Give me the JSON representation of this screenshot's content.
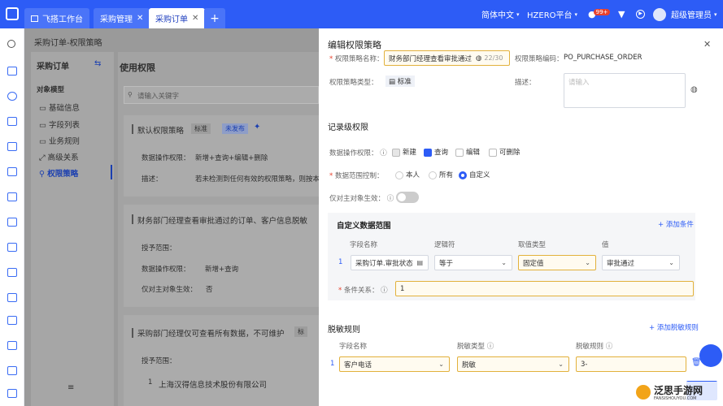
{
  "topbar": {
    "tabs": [
      {
        "label": "飞搭工作台"
      },
      {
        "label": "采购管理"
      },
      {
        "label": "采购订单"
      }
    ],
    "add": "+",
    "lang": "简体中文",
    "platform": "HZERO平台",
    "badge": "99+",
    "user": "超级管理员"
  },
  "bg": {
    "breadcrumb": "采购订单-权限策略",
    "nav_title": "采购订单",
    "section_label": "对象模型",
    "nav_items": [
      "基础信息",
      "字段列表",
      "业务规则",
      "高级关系",
      "权限策略"
    ],
    "col_title": "使用权限",
    "search_placeholder": "请输入关键字",
    "card1": {
      "title": "默认权限策略",
      "tag1": "标准",
      "tag2": "未发布",
      "ops_label": "数据操作权限：",
      "ops_value": "新增+查询+编辑+删除",
      "desc_label": "描述：",
      "desc_value": "若未检测到任何有效的权限策略，则按本策"
    },
    "card2": {
      "title": "财务部门经理查看审批通过的订单、客户信息脱敏",
      "scope_label": "授予范围：",
      "ops_label": "数据操作权限：",
      "ops_value": "新增+查询",
      "owner_label": "仅对主对象生效：",
      "owner_value": "否"
    },
    "card3": {
      "title": "采购部门经理仅可查看所有数据，不可维护",
      "tag": "标",
      "scope_label": "授予范围：",
      "index": "1",
      "company": "上海汉得信息技术股份有限公司"
    }
  },
  "panel": {
    "title": "编辑权限策略",
    "name_label": "权限策略名称：",
    "name_value": "财务部门经理查看审批通过",
    "name_count": "22/30",
    "code_label": "权限策略编码：",
    "code_value": "PO_PURCHASE_ORDER",
    "type_label": "权限策略类型：",
    "type_value": "标准",
    "desc_label": "描述：",
    "desc_placeholder": "请输入",
    "record_title": "记录级权限",
    "ops_label": "数据操作权限：",
    "ops": [
      "新建",
      "查询",
      "编辑",
      "可删除"
    ],
    "range_label": "数据范围控制：",
    "ranges": [
      "本人",
      "所有",
      "自定义"
    ],
    "main_only_label": "仅对主对象生效：",
    "custom_title": "自定义数据范围",
    "add_cond": "添加条件",
    "cols": [
      "字段名称",
      "逻辑符",
      "取值类型",
      "值"
    ],
    "row": {
      "index": "1",
      "field": "采购订单.审批状态",
      "op": "等于",
      "vtype": "固定值",
      "value": "审批通过"
    },
    "cond_label": "条件关系：",
    "cond_value": "1",
    "mask_title": "脱敏规则",
    "add_mask": "添加脱敏规则",
    "mask_cols": [
      "字段名称",
      "脱敏类型",
      "脱敏规则"
    ],
    "mask_row": {
      "index": "1",
      "field": "客户电话",
      "mtype": "脱敏",
      "rule": "3-"
    }
  },
  "watermark": {
    "title": "泛思手游网",
    "sub": "FANSISHOUYOU.COM"
  }
}
